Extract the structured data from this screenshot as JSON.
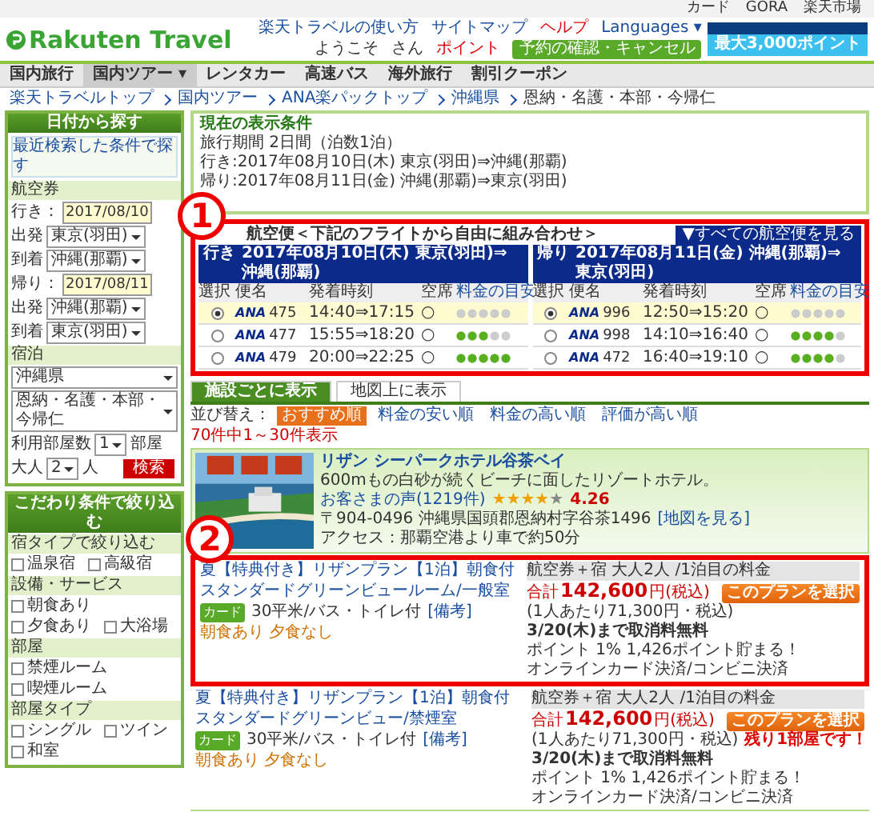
{
  "top_links": [
    "カード",
    "GORA",
    "楽天市場"
  ],
  "header": {
    "logo": "Rakuten Travel",
    "links": [
      "楽天トラベルの使い方",
      "サイトマップ",
      "ヘルプ",
      "Languages ▾"
    ],
    "welcome": "ようこそ",
    "san": "さん",
    "points": "ポイント",
    "reserve_button": "予約の確認・キャンセル",
    "banner": "最大3,000ポイント"
  },
  "nav": [
    {
      "label": "国内旅行",
      "selected": false
    },
    {
      "label": "国内ツアー ▾",
      "selected": true
    },
    {
      "label": "レンタカー",
      "selected": false
    },
    {
      "label": "高速バス",
      "selected": false
    },
    {
      "label": "海外旅行",
      "selected": false
    },
    {
      "label": "割引クーポン",
      "selected": false
    }
  ],
  "breadcrumb": [
    "楽天トラベルトップ",
    "国内ツアー",
    "ANA楽パックトップ",
    "沖縄県",
    "恩納・名護・本部・今帰仁"
  ],
  "sidebar": {
    "title": "日付から探す",
    "recent": "最近検索した条件で探す",
    "air_label": "航空券",
    "legs": [
      {
        "label": "行き：",
        "date": "2017/08/10",
        "depart_label": "出発",
        "depart": "東京(羽田)",
        "arrive_label": "到着",
        "arrive": "沖縄(那覇)"
      },
      {
        "label": "帰り：",
        "date": "2017/08/11",
        "depart_label": "出発",
        "depart": "沖縄(那覇)",
        "arrive_label": "到着",
        "arrive": "東京(羽田)"
      }
    ],
    "stay_label": "宿泊",
    "prefecture": "沖縄県",
    "area": "恩納・名護・本部・今帰仁",
    "rooms_label": "利用部屋数",
    "rooms": "1",
    "rooms_unit": "部屋",
    "adults_label": "大人",
    "adults": "2",
    "adults_unit": "人",
    "search_button": "検索",
    "filter_title": "こだわり条件で絞り込む",
    "filter_groups": [
      {
        "title": "宿タイプで絞り込む",
        "options": [
          {
            "label": "温泉宿",
            "checked": false
          },
          {
            "label": "高級宿",
            "checked": false
          }
        ]
      },
      {
        "title": "設備・サービス",
        "options": [
          {
            "label": "朝食あり",
            "checked": false
          },
          {
            "label": "夕食あり",
            "checked": false
          },
          {
            "label": "大浴場",
            "checked": false
          }
        ]
      },
      {
        "title": "部屋",
        "options": [
          {
            "label": "禁煙ルーム",
            "checked": false
          },
          {
            "label": "喫煙ルーム",
            "checked": false
          }
        ]
      },
      {
        "title": "部屋タイプ",
        "options": [
          {
            "label": "シングル",
            "checked": false
          },
          {
            "label": "ツイン",
            "checked": false
          },
          {
            "label": "和室",
            "checked": false
          }
        ]
      }
    ]
  },
  "conditions": {
    "title": "現在の表示条件",
    "lines": [
      "旅行期間 2日間（泊数1泊）",
      "行き:2017年08月10日(木) 東京(羽田)⇒沖縄(那覇)",
      "帰り:2017年08月11日(金) 沖縄(那覇)⇒東京(羽田)"
    ]
  },
  "flights": {
    "annotation": "1",
    "highlighted": true,
    "title": "航空便＜下記のフライトから自由に組み合わせ＞",
    "all_button": "▼すべての航空便を見る",
    "legs": [
      {
        "direction": "行き",
        "heading": "2017年08月10日(木) 東京(羽田)⇒沖縄(那覇)",
        "columns": [
          "選択",
          "便名",
          "発着時刻",
          "空席",
          "料金の目安"
        ],
        "rows": [
          {
            "airline": "ANA",
            "flight": "475",
            "time": "14:40⇒17:15",
            "seat": "○",
            "level": 0,
            "selected": true
          },
          {
            "airline": "ANA",
            "flight": "477",
            "time": "15:55⇒18:20",
            "seat": "○",
            "level": 0.6,
            "selected": false
          },
          {
            "airline": "ANA",
            "flight": "479",
            "time": "20:00⇒22:25",
            "seat": "○",
            "level": 1,
            "selected": false
          }
        ]
      },
      {
        "direction": "帰り",
        "heading": "2017年08月11日(金) 沖縄(那覇)⇒東京(羽田)",
        "columns": [
          "選択",
          "便名",
          "発着時刻",
          "空席",
          "料金の目安"
        ],
        "rows": [
          {
            "airline": "ANA",
            "flight": "996",
            "time": "12:50⇒15:20",
            "seat": "○",
            "level": 0,
            "selected": true
          },
          {
            "airline": "ANA",
            "flight": "998",
            "time": "14:10⇒16:40",
            "seat": "○",
            "level": 0.8,
            "selected": false
          },
          {
            "airline": "ANA",
            "flight": "472",
            "time": "16:40⇒19:10",
            "seat": "○",
            "level": 0.8,
            "selected": false
          }
        ]
      }
    ]
  },
  "tabs": [
    {
      "label": "施設ごとに表示",
      "selected": true
    },
    {
      "label": "地図上に表示",
      "selected": false
    }
  ],
  "sort": {
    "label": "並び替え：",
    "options": [
      {
        "label": "おすすめ順",
        "selected": true
      },
      {
        "label": "料金の安い順",
        "selected": false
      },
      {
        "label": "料金の高い順",
        "selected": false
      },
      {
        "label": "評価が高い順",
        "selected": false
      }
    ]
  },
  "count": "70件中1～30件表示",
  "hotel": {
    "kind": "picture",
    "name": "リザン シーパークホテル谷茶ベイ",
    "description": "600mもの白砂が続くビーチに面したリゾートホテル。",
    "reviews": "お客さまの声(1219件)",
    "stars": 4,
    "score": "4.26",
    "address": "〒904-0496 沖縄県国頭郡恩納村字谷茶1496",
    "map_link": "[地図を見る]",
    "access": "アクセス：那覇空港より車で約50分"
  },
  "plans": [
    {
      "highlighted": true,
      "annotation": "2",
      "title": "夏【特典付き】リザンプラン【1泊】朝食付",
      "room": "スタンダードグリーンビュールーム/一般室",
      "badge": "カード",
      "size": "30平米/バス・トイレ付",
      "note_link": "[備考]",
      "meals": "朝食あり 夕食なし",
      "fare_label": "航空券＋宿 大人2人 /1泊目の料金",
      "total_label": "合計",
      "total": "142,600",
      "total_unit": "円(税込)",
      "per_person": "(1人あたり71,300円・税込)",
      "cancel": "3/20(木)まで取消料無料",
      "points": "ポイント 1% 1,426ポイント貯まる！",
      "payment": "オンラインカード決済/コンビニ決済",
      "select_button": "このプランを選択"
    },
    {
      "highlighted": false,
      "title": "夏【特典付き】リザンプラン【1泊】朝食付",
      "room": "スタンダードグリーンビュー/禁煙室",
      "badge": "カード",
      "size": "30平米/バス・トイレ付",
      "note_link": "[備考]",
      "meals": "朝食あり 夕食なし",
      "fare_label": "航空券＋宿 大人2人 /1泊目の料金",
      "total_label": "合計",
      "total": "142,600",
      "total_unit": "円(税込)",
      "per_person": "(1人あたり71,300円・税込)",
      "cancel": "3/20(木)まで取消料無料",
      "points": "ポイント 1% 1,426ポイント貯まる！",
      "payment": "オンラインカード決済/コンビニ決済",
      "select_button": "このプランを選択",
      "remaining": "残り1部屋です！"
    }
  ]
}
